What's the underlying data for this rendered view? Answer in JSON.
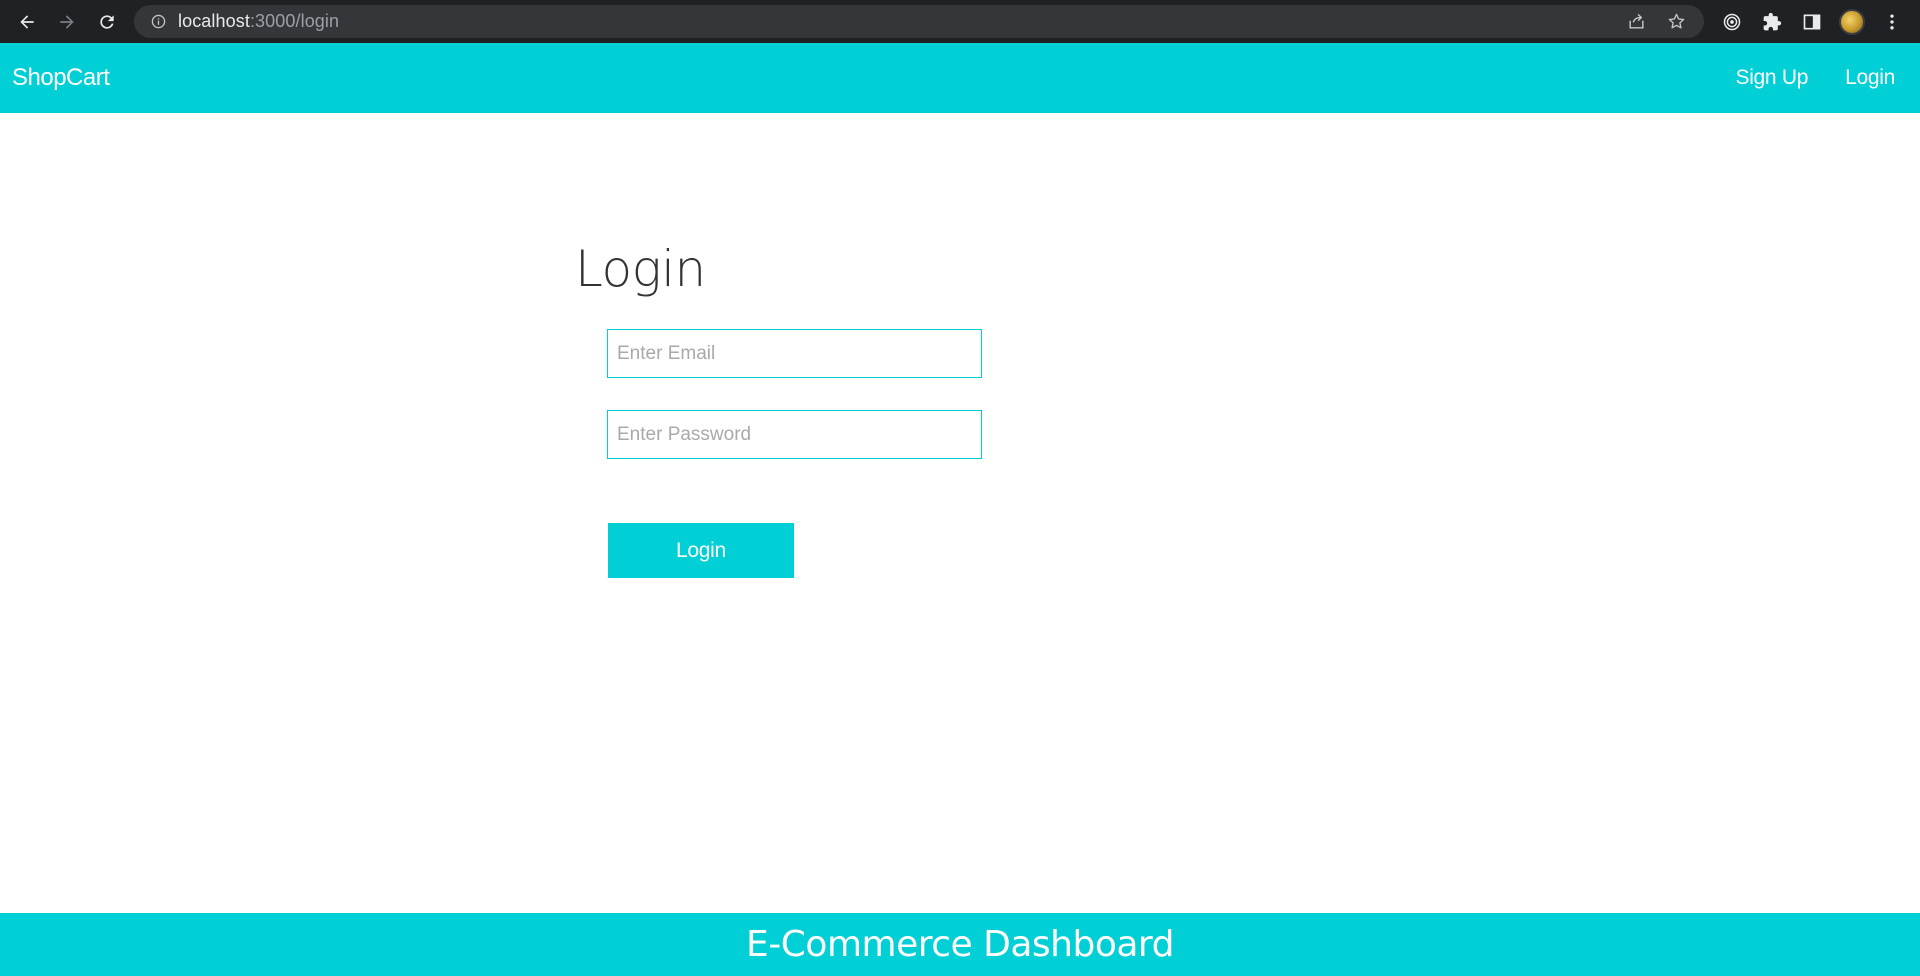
{
  "browser": {
    "url_host": "localhost",
    "url_path": ":3000/login",
    "icons": {
      "back": "back-arrow-icon",
      "forward": "forward-arrow-icon",
      "reload": "reload-icon",
      "info": "info-icon",
      "share": "share-icon",
      "bookmark": "star-icon",
      "extension_target": "target-icon",
      "extensions": "puzzle-icon",
      "side_panel": "side-panel-icon",
      "menu": "kebab-menu-icon"
    }
  },
  "navbar": {
    "brand": "ShopCart",
    "links": [
      {
        "label": "Sign Up"
      },
      {
        "label": "Login"
      }
    ],
    "color": "#00cfd5"
  },
  "login": {
    "title": "Login",
    "email_placeholder": "Enter Email",
    "password_placeholder": "Enter Password",
    "button_label": "Login"
  },
  "footer": {
    "text": "E-Commerce Dashboard"
  }
}
